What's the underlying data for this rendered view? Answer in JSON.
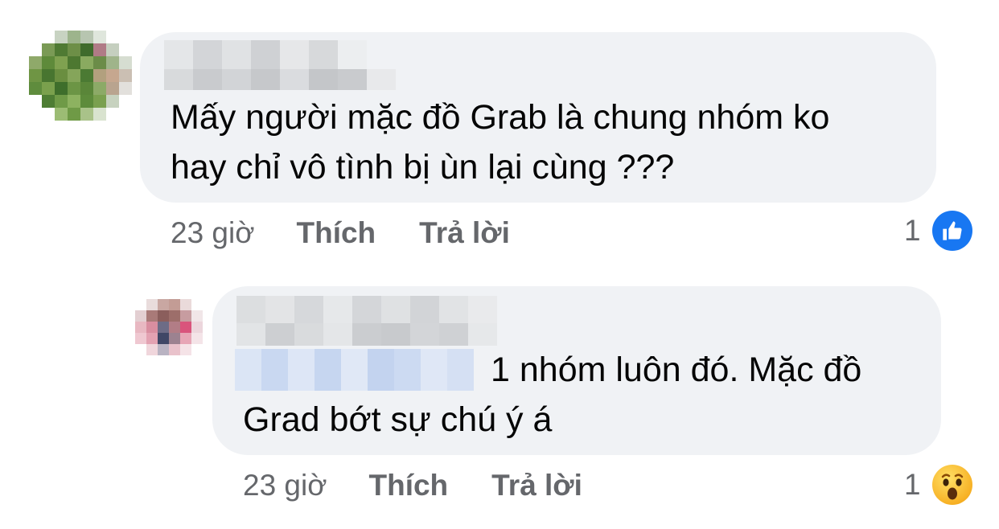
{
  "comments": [
    {
      "text_line1": "Mấy người mặc đồ Grab là chung nhóm ko",
      "text_line2": "hay chỉ vô tình bị ùn lại cùng ???",
      "time": "23 giờ",
      "like_label": "Thích",
      "reply_label": "Trả lời",
      "reaction_count": "1",
      "reaction_icon": "like-icon"
    },
    {
      "text_line1_rest": "1 nhóm luôn đó. Mặc đồ",
      "text_line2": "Grad bớt sự chú ý á",
      "time": "23 giờ",
      "like_label": "Thích",
      "reply_label": "Trả lời",
      "reaction_count": "1",
      "reaction_icon": "wow-icon"
    }
  ],
  "colors": {
    "bubble": "#f0f2f5",
    "meta_text": "#65676b",
    "like_blue": "#1877f2",
    "wow_yellow": "#f7b125"
  }
}
